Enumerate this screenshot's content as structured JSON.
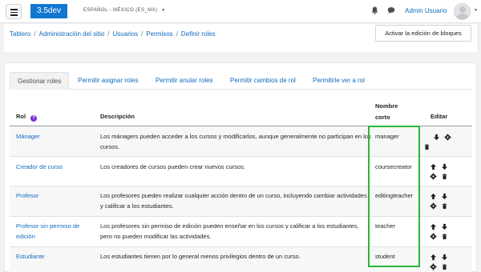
{
  "navbar": {
    "brand": "3.5dev",
    "language": "ESPAÑOL - MÉXICO (ES_MX)",
    "user_name": "Admin Usuario"
  },
  "breadcrumb": [
    "Tablero",
    "Administración del sitio",
    "Usuarios",
    "Permisos",
    "Definir roles"
  ],
  "edit_button": "Activar la edición de bloques",
  "tabs": [
    "Gestionar roles",
    "Permitir asignar roles",
    "Permitir anular roles",
    "Permitir cambios de rol",
    "Permitirle ver a rol"
  ],
  "table": {
    "headers": {
      "role": "Rol",
      "description": "Descripción",
      "shortname_1": "Nombre",
      "shortname_2": "corto",
      "edit": "Editar"
    },
    "rows": [
      {
        "name": "Mánager",
        "description": "Los mánagers pueden acceder a los cursos y modificarlos, aunque generalmente no participan en los cursos.",
        "shortname": "manager"
      },
      {
        "name": "Creador de curso",
        "description": "Los creadores de cursos pueden crear nuevos cursos.",
        "shortname": "coursecreator"
      },
      {
        "name": "Profesor",
        "description": "Los profesores pueden realizar cualquier acción dentro de un curso, incluyendo cambiar actividades y calificar a los estudiantes.",
        "shortname": "editingteacher"
      },
      {
        "name": "Profesor sin permiso de edición",
        "description": "Los profesores sin permiso de edición pueden enseñar en los cursos y calificar a los estudiantes, pero no pueden modificar las actividades.",
        "shortname": "teacher"
      },
      {
        "name": "Estudiante",
        "description": "Los estudiantes tienen por lo general menos privilegios dentro de un curso.",
        "shortname": "student"
      }
    ]
  },
  "icons": {
    "help": "question-circle-icon",
    "up": "arrow-up-icon",
    "down": "arrow-down-icon",
    "settings": "gear-icon",
    "delete": "trash-icon",
    "notifications": "bell-icon",
    "messages": "chat-icon"
  },
  "colors": {
    "brand": "#1177d1",
    "link": "#0f6cbf",
    "highlight": "#2db43a",
    "help": "#7a2ed6"
  }
}
